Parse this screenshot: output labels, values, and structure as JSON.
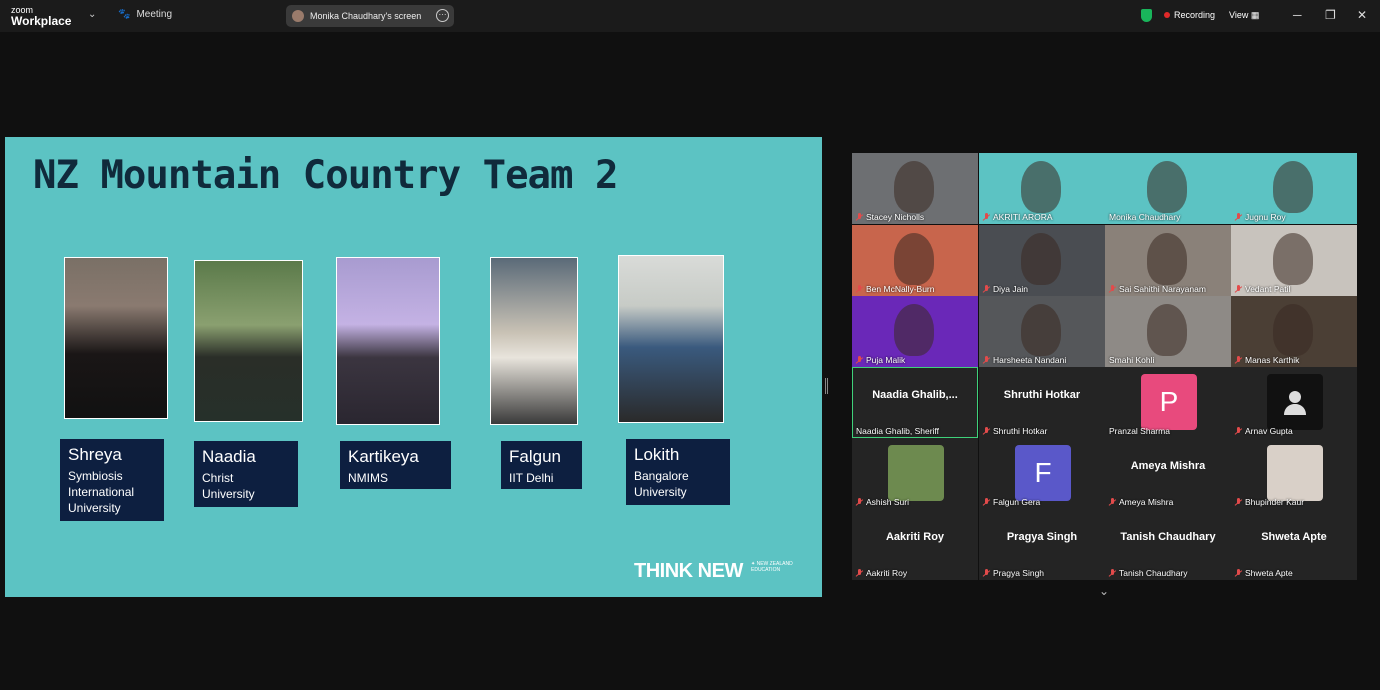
{
  "titlebar": {
    "brand_small": "zoom",
    "brand": "Workplace",
    "meeting_label": "Meeting",
    "share_label": "Monika Chaudhary's screen",
    "recording_label": "Recording",
    "view_label": "View",
    "minimize": "─",
    "restore": "❐",
    "close": "✕"
  },
  "slide": {
    "title": "NZ Mountain Country Team 2",
    "members": [
      {
        "name": "Shreya",
        "org": "Symbiosis International University",
        "org_lines": [
          "Symbiosis",
          "International",
          "University"
        ]
      },
      {
        "name": "Naadia",
        "org_lines": [
          "Christ",
          "University"
        ]
      },
      {
        "name": "Kartikeya",
        "org_lines": [
          "NMIMS"
        ]
      },
      {
        "name": "Falgun",
        "org_lines": [
          "IIT Delhi"
        ]
      },
      {
        "name": "Lokith",
        "org_lines": [
          "Bangalore",
          "University"
        ]
      }
    ],
    "brand_text": "THINK NEW",
    "logo_text": "NEW ZEALAND EDUCATION"
  },
  "gallery": {
    "tiles": [
      {
        "label": "Stacey Nicholls",
        "muted": true,
        "video": true,
        "bg": "#6d6f72"
      },
      {
        "label": "AKRITI ARORA",
        "muted": true,
        "video": true,
        "bg": "#5cc3c3"
      },
      {
        "label": "Monika Chaudhary",
        "muted": false,
        "video": true,
        "bg": "#5cc3c3"
      },
      {
        "label": "Jugnu Roy",
        "muted": true,
        "video": true,
        "bg": "#5cc3c3"
      },
      {
        "label": "Ben McNally-Burn",
        "muted": true,
        "video": true,
        "bg": "#c8654c"
      },
      {
        "label": "Diya Jain",
        "muted": true,
        "video": true,
        "bg": "#4a4d52"
      },
      {
        "label": "Sai Sahithi Narayanam",
        "muted": true,
        "video": true,
        "bg": "#8a8179"
      },
      {
        "label": "Vedant Patil",
        "muted": true,
        "video": true,
        "bg": "#c8c3bd"
      },
      {
        "label": "Puja Malik",
        "muted": true,
        "video": true,
        "bg": "#6a28b8"
      },
      {
        "label": "Harsheeta Nandani",
        "muted": true,
        "video": true,
        "bg": "#55575a"
      },
      {
        "label": "Smahi Kohli",
        "muted": false,
        "video": true,
        "bg": "#8e8a86"
      },
      {
        "label": "Manas Karthik",
        "muted": true,
        "video": true,
        "bg": "#4b3f35"
      },
      {
        "label": "Naadia Ghalib, Sheriff",
        "big": "Naadia  Ghalib,...",
        "muted": false,
        "active": true
      },
      {
        "label": "Shruthi Hotkar",
        "big": "Shruthi Hotkar",
        "muted": true
      },
      {
        "label": "Pranzal Sharma",
        "avatar": "P",
        "avatar_bg": "#e84a7d",
        "muted": false
      },
      {
        "label": "Arnav Gupta",
        "avatar": "person",
        "avatar_bg": "#111111",
        "muted": true
      },
      {
        "label": "Ashish Suri",
        "avatar": "photo",
        "avatar_bg": "#6d8a4f",
        "muted": true
      },
      {
        "label": "Falgun Gera",
        "avatar": "F",
        "avatar_bg": "#5a58c9",
        "muted": true
      },
      {
        "label": "Ameya Mishra",
        "big": "Ameya Mishra",
        "muted": true
      },
      {
        "label": "Bhupinder Kaur",
        "avatar": "photo",
        "avatar_bg": "#d9d0c8",
        "muted": true
      },
      {
        "label": "Aakriti Roy",
        "big": "Aakriti Roy",
        "muted": true
      },
      {
        "label": "Pragya Singh",
        "big": "Pragya Singh",
        "muted": true
      },
      {
        "label": "Tanish Chaudhary",
        "big": "Tanish Chaudhary",
        "muted": true
      },
      {
        "label": "Shweta Apte",
        "big": "Shweta Apte",
        "muted": true
      }
    ]
  },
  "colors": {
    "slide_bg": "#5cc3c3",
    "title_color": "#102a3b",
    "namecard_bg": "#0d1f40",
    "recording_dot": "#e02929",
    "active_speaker": "#3fd17a"
  }
}
